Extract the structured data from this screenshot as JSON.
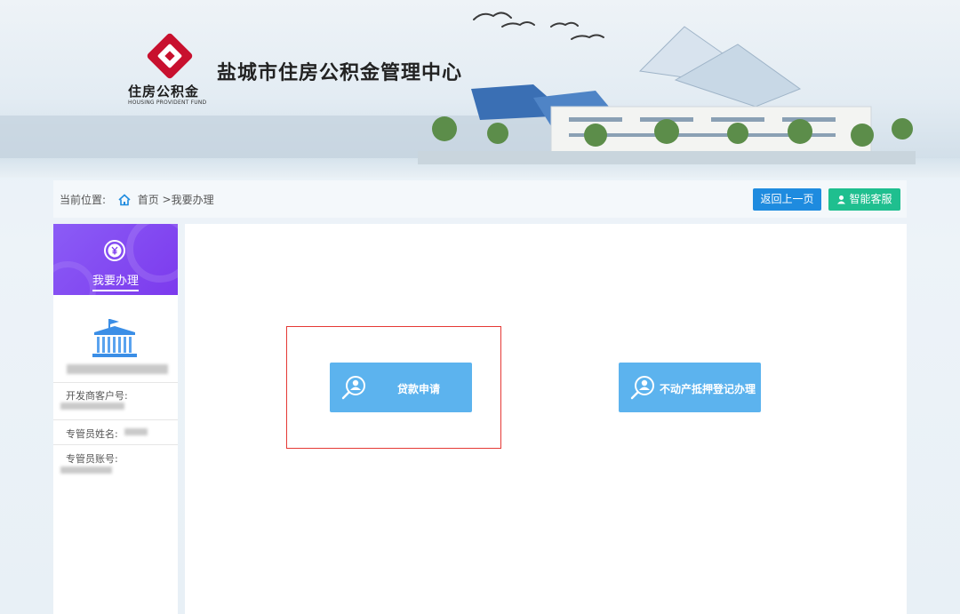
{
  "header": {
    "logo_cn": "住房公积金",
    "logo_en": "HOUSING PROVIDENT FUND",
    "title": "盐城市住房公积金管理中心"
  },
  "breadcrumb": {
    "prefix": "当前位置:",
    "home": "首页",
    "separator": ">",
    "current": "我要办理"
  },
  "toolbar": {
    "back_label": "返回上一页",
    "service_label": "智能客服"
  },
  "sidebar": {
    "section_label": "我要办理",
    "fields": [
      {
        "label": "开发商客户号:"
      },
      {
        "label": "专管员姓名:"
      },
      {
        "label": "专管员账号:"
      }
    ],
    "header_color": "#8b5cf6"
  },
  "actions": [
    {
      "label": "贷款申请",
      "icon": "user-search-icon"
    },
    {
      "label": "不动产抵押登记办理",
      "icon": "user-search-icon"
    }
  ],
  "colors": {
    "logo_red": "#c8102e",
    "back_button": "#1e8bdf",
    "service_button": "#1fbf8f",
    "action_button": "#5cb3ee",
    "highlight_border": "#e53935"
  }
}
